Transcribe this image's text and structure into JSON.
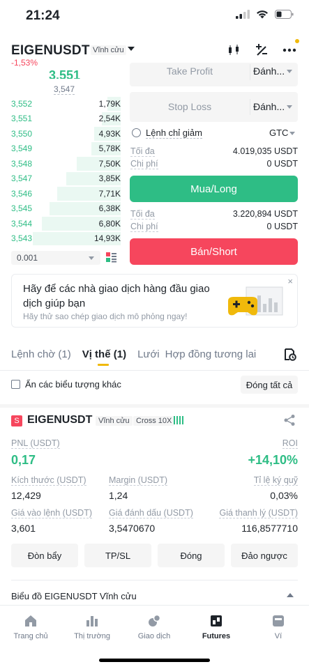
{
  "status_bar": {
    "time": "21:24"
  },
  "header": {
    "pair": "EIGENUSDT",
    "contract_type": "Vĩnh cửu",
    "change": "-1,53%"
  },
  "order_book": {
    "last_price": "3,551",
    "mark_price": "3,547",
    "rows": [
      {
        "price": "3,552",
        "qty": "1,79K",
        "depth": 0.12
      },
      {
        "price": "3,551",
        "qty": "2,54K",
        "depth": 0.17
      },
      {
        "price": "3,550",
        "qty": "4,93K",
        "depth": 0.24
      },
      {
        "price": "3,549",
        "qty": "5,78K",
        "depth": 0.27
      },
      {
        "price": "3,548",
        "qty": "7,50K",
        "depth": 0.4
      },
      {
        "price": "3,547",
        "qty": "3,85K",
        "depth": 0.5
      },
      {
        "price": "3,546",
        "qty": "7,71K",
        "depth": 0.58
      },
      {
        "price": "3,545",
        "qty": "6,38K",
        "depth": 0.65
      },
      {
        "price": "3,544",
        "qty": "6,80K",
        "depth": 0.72
      },
      {
        "price": "3,543",
        "qty": "14,93K",
        "depth": 0.8
      }
    ],
    "precision": "0.001"
  },
  "order_form": {
    "take_profit_placeholder": "Take Profit",
    "take_profit_select": "Đánh...",
    "stop_loss_placeholder": "Stop Loss",
    "stop_loss_select": "Đánh...",
    "reduce_only": "Lệnh chỉ giảm",
    "time_in_force": "GTC",
    "buy_max_label": "Tối đa",
    "buy_max_value": "4.019,035 USDT",
    "buy_cost_label": "Chi phí",
    "buy_cost_value": "0 USDT",
    "buy_button": "Mua/Long",
    "sell_max_label": "Tối đa",
    "sell_max_value": "3.220,894 USDT",
    "sell_cost_label": "Chi phí",
    "sell_cost_value": "0 USDT",
    "sell_button": "Bán/Short"
  },
  "banner": {
    "title": "Hãy để các nhà giao dịch hàng đầu giao dịch giúp bạn",
    "subtitle": "Hãy thử sao chép giao dịch mô phỏng ngay!",
    "close": "×"
  },
  "tabs": [
    {
      "label": "Lệnh chờ (1)"
    },
    {
      "label": "Vị thế (1)"
    },
    {
      "label": "Lưới"
    },
    {
      "label": "Hợp đồng tương lai"
    }
  ],
  "positions_toolbar": {
    "hide_others": "Ẩn các biểu tượng khác",
    "close_all": "Đóng tất cả"
  },
  "position": {
    "side_badge": "S",
    "symbol": "EIGENUSDT",
    "contract_type": "Vĩnh cửu",
    "margin_mode": "Cross 10X",
    "pnl_label": "PNL (USDT)",
    "pnl_value": "0,17",
    "roi_label": "ROI",
    "roi_value": "+14,10%",
    "size_label": "Kích thước (USDT)",
    "size_value": "12,429",
    "margin_label": "Margin (USDT)",
    "margin_value": "1,24",
    "margin_ratio_label": "Tỉ lệ ký quỹ",
    "margin_ratio_value": "0,03%",
    "entry_label": "Giá vào lệnh (USDT)",
    "entry_value": "3,601",
    "mark_label": "Giá đánh dấu (USDT)",
    "mark_value": "3,5470670",
    "liq_label": "Giá thanh lý (USDT)",
    "liq_value": "116,8577710",
    "actions": [
      "Đòn bẩy",
      "TP/SL",
      "Đóng",
      "Đảo ngược"
    ]
  },
  "chart_link": "Biểu đồ EIGENUSDT Vĩnh cửu",
  "bottom_nav": [
    {
      "label": "Trang chủ",
      "icon": "home-icon"
    },
    {
      "label": "Thị trường",
      "icon": "markets-icon"
    },
    {
      "label": "Giao dịch",
      "icon": "trade-icon"
    },
    {
      "label": "Futures",
      "icon": "futures-icon"
    },
    {
      "label": "Ví",
      "icon": "wallet-icon"
    }
  ],
  "colors": {
    "green": "#2ebd85",
    "red": "#f6465d",
    "accent": "#f0b90b"
  }
}
